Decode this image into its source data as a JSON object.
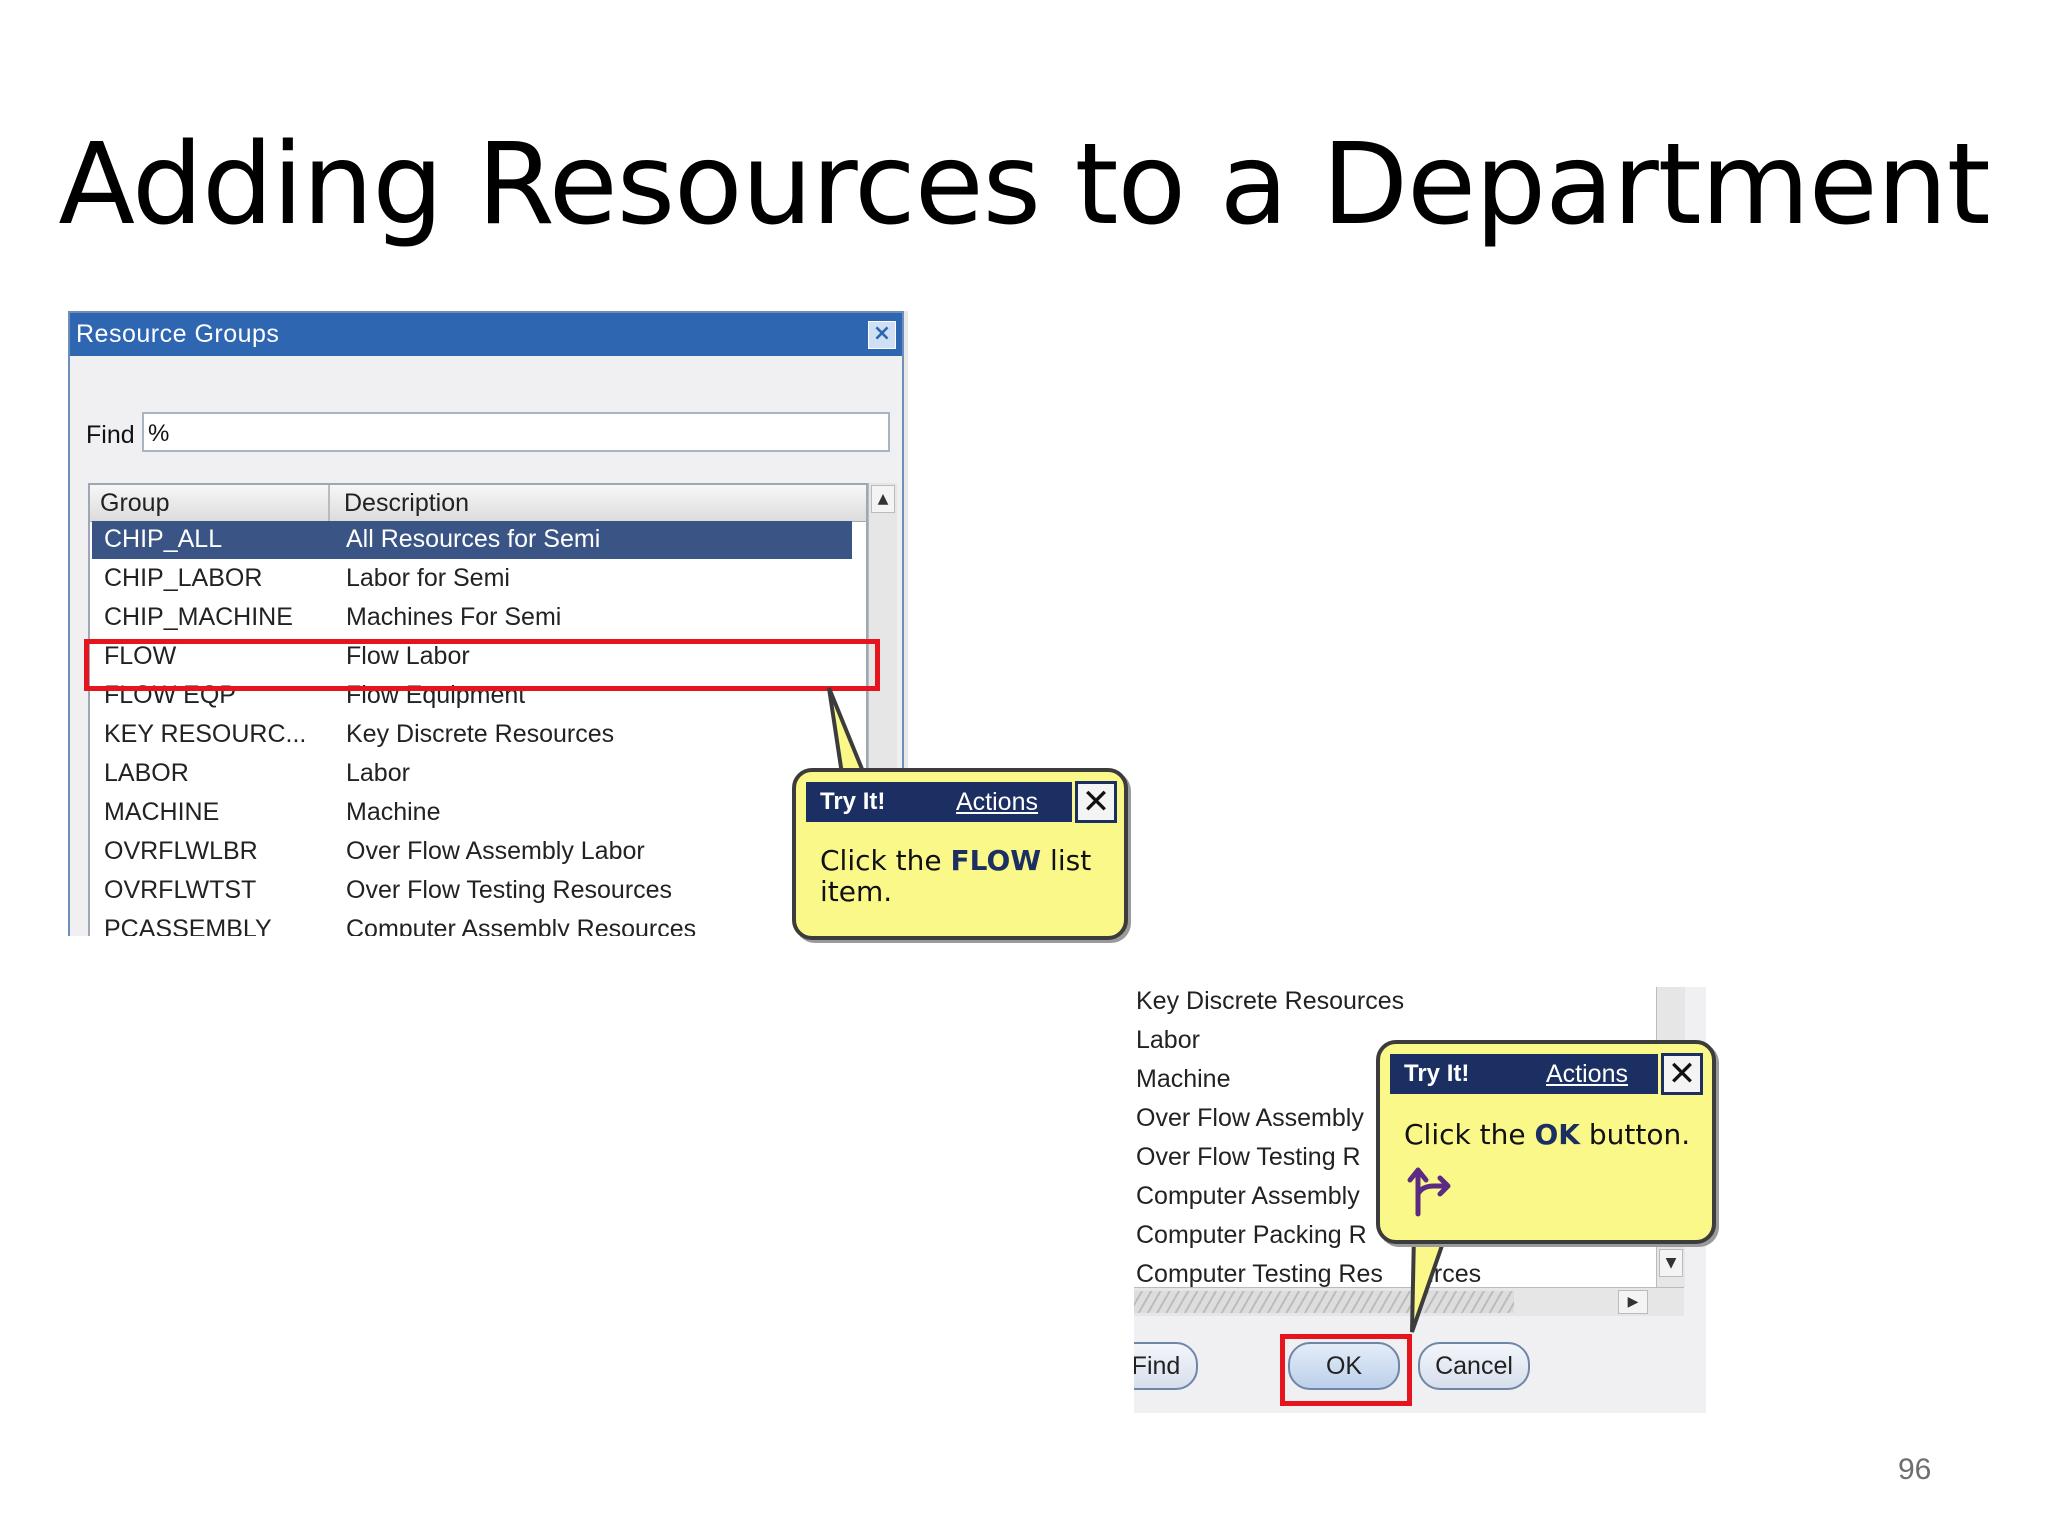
{
  "slide": {
    "title": "Adding Resources to a Department",
    "page_number": "96"
  },
  "dialog": {
    "title": "Resource Groups",
    "close_glyph": "×",
    "find_label": "Find",
    "find_value": "%",
    "columns": [
      "Group",
      "Description"
    ],
    "rows": [
      {
        "group": "CHIP_ALL",
        "description": "All Resources for Semi",
        "selected": true
      },
      {
        "group": "CHIP_LABOR",
        "description": "Labor for Semi"
      },
      {
        "group": "CHIP_MACHINE",
        "description": "Machines For Semi"
      },
      {
        "group": "FLOW",
        "description": "Flow Labor",
        "highlighted": true
      },
      {
        "group": "FLOW EQP",
        "description": "Flow Equipment"
      },
      {
        "group": "KEY RESOURC...",
        "description": "Key Discrete Resources"
      },
      {
        "group": "LABOR",
        "description": "Labor"
      },
      {
        "group": "MACHINE",
        "description": "Machine"
      },
      {
        "group": "OVRFLWLBR",
        "description": "Over Flow Assembly Labor"
      },
      {
        "group": "OVRFLWTST",
        "description": "Over Flow Testing Resources"
      },
      {
        "group": "PCASSEMBLY",
        "description": "Computer Assembly Resources"
      }
    ],
    "scroll_up_glyph": "▲"
  },
  "callout1": {
    "try_it": "Try It!",
    "actions": "Actions",
    "close_glyph": "✕",
    "text_before": "Click the ",
    "text_bold": "FLOW",
    "text_after": " list item."
  },
  "list2": {
    "items": [
      "Key Discrete Resources",
      "Labor",
      "Machine",
      "Over Flow Assembly",
      "Over Flow Testing R",
      "Computer Assembly",
      "Computer Packing R",
      "Computer Testing Res",
      "urces"
    ],
    "scroll_down_glyph": "▼",
    "scroll_right_glyph": "▶",
    "buttons": {
      "find": "Find",
      "ok": "OK",
      "cancel": "Cancel"
    }
  },
  "callout2": {
    "try_it": "Try It!",
    "actions": "Actions",
    "close_glyph": "✕",
    "text_before": "Click the ",
    "text_bold": "OK",
    "text_after": " button.",
    "icon": "branch-arrow-icon",
    "icon_color": "#5b2b84"
  }
}
